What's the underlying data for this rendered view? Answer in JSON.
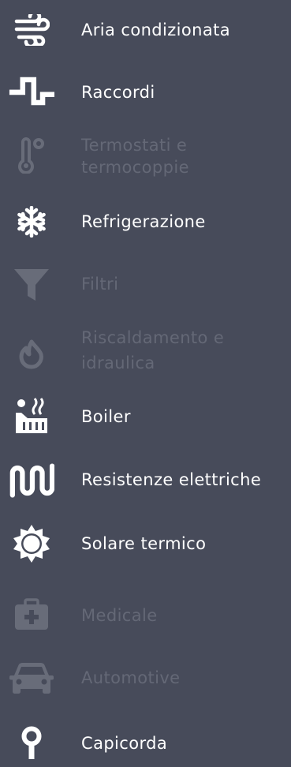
{
  "menu": {
    "items": [
      {
        "label": "Aria condizionata",
        "icon": "wind-icon",
        "state": "active"
      },
      {
        "label": "Raccordi",
        "icon": "pipe-fitting-icon",
        "state": "active"
      },
      {
        "label": "Termostati e",
        "label2": "termocoppie",
        "icon": "thermometer-icon",
        "state": "disabled"
      },
      {
        "label": "Refrigerazione",
        "icon": "snowflake-icon",
        "state": "active"
      },
      {
        "label": "Filtri",
        "icon": "filter-icon",
        "state": "disabled"
      },
      {
        "label": "Riscaldamento e",
        "label2": "idraulica",
        "icon": "flame-icon",
        "state": "disabled"
      },
      {
        "label": "Boiler",
        "icon": "boiler-icon",
        "state": "active"
      },
      {
        "label": "Resistenze elettriche",
        "icon": "heating-coil-icon",
        "state": "active"
      },
      {
        "label": "Solare termico",
        "icon": "sun-icon",
        "state": "active"
      },
      {
        "label": "Medicale",
        "icon": "medical-kit-icon",
        "state": "disabled"
      },
      {
        "label": "Automotive",
        "icon": "car-icon",
        "state": "disabled"
      },
      {
        "label": "Capicorda",
        "icon": "cable-lug-icon",
        "state": "active"
      }
    ]
  },
  "colors": {
    "background": "#474b5a",
    "active": "#ffffff",
    "disabled": "#646876"
  }
}
